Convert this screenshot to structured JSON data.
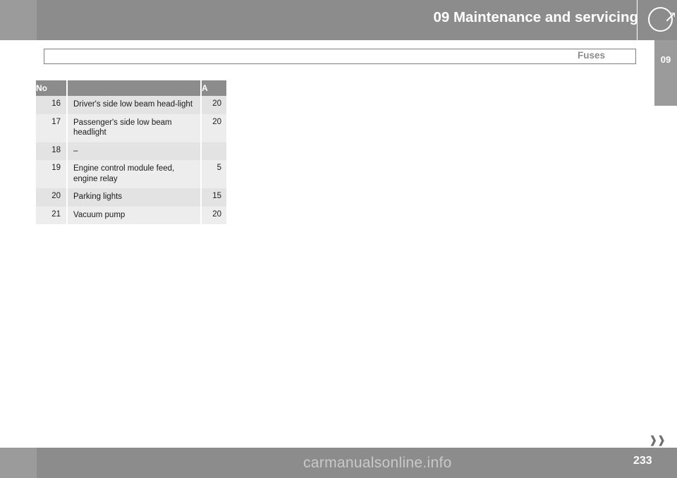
{
  "header": {
    "title": "09 Maintenance and servicing",
    "logo_icon": "volvo-circle-arrow-icon"
  },
  "side_tab": {
    "label": "09"
  },
  "running_head": {
    "text": "Fuses"
  },
  "table": {
    "columns": [
      "No",
      "",
      "A"
    ],
    "rows": [
      {
        "no": "16",
        "desc": "Driver's side low beam head-light",
        "a": "20"
      },
      {
        "no": "17",
        "desc": "Passenger's side low beam headlight",
        "a": "20"
      },
      {
        "no": "18",
        "desc": "–",
        "a": ""
      },
      {
        "no": "19",
        "desc": "Engine control module feed, engine relay",
        "a": "5"
      },
      {
        "no": "20",
        "desc": "Parking lights",
        "a": "15"
      },
      {
        "no": "21",
        "desc": "Vacuum pump",
        "a": "20"
      }
    ]
  },
  "footer": {
    "page_number": "233",
    "nav_arrows": "❱❱",
    "watermark": "carmanualsonline.info"
  }
}
